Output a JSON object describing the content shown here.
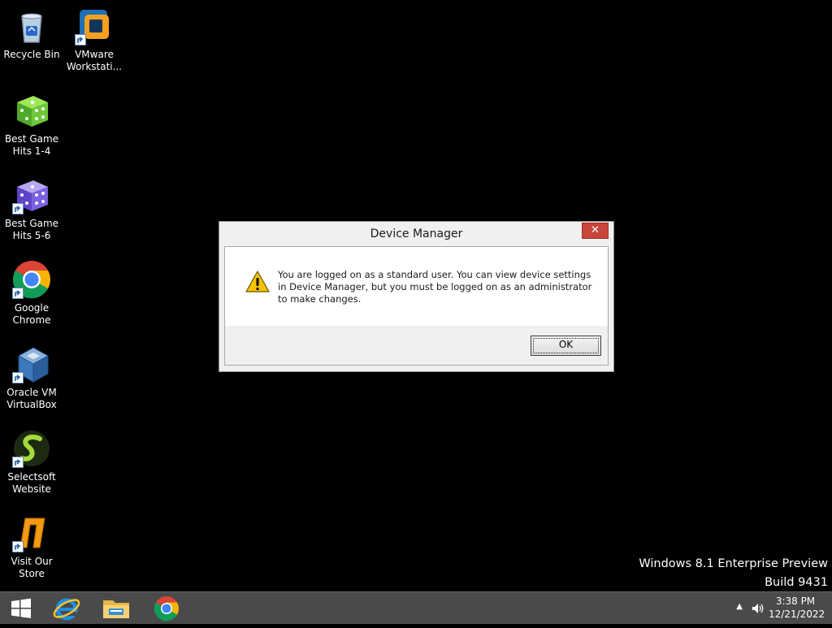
{
  "desktop": {
    "icons": [
      {
        "label": "Recycle Bin",
        "icon": "recycle-bin-icon"
      },
      {
        "label": "VMware Workstati...",
        "icon": "vmware-icon"
      },
      {
        "label": "Best Game Hits 1-4",
        "icon": "green-dice-icon"
      },
      {
        "label": "Best Game Hits 5-6",
        "icon": "purple-dice-icon"
      },
      {
        "label": "Google Chrome",
        "icon": "chrome-icon"
      },
      {
        "label": "Oracle VM VirtualBox",
        "icon": "virtualbox-icon"
      },
      {
        "label": "Selectsoft Website",
        "icon": "selectsoft-icon"
      },
      {
        "label": "Visit Our Store",
        "icon": "store-icon"
      }
    ]
  },
  "watermark": {
    "line1": "Windows 8.1 Enterprise Preview",
    "line2": "Build 9431"
  },
  "dialog": {
    "title": "Device Manager",
    "close_label": "✕",
    "message": "You are logged on as a standard user. You can view device settings in Device Manager, but you must be logged on as an administrator to make changes.",
    "ok_label": "OK",
    "icon": "warning-icon"
  },
  "taskbar": {
    "items": [
      "start-button",
      "internet-explorer-icon",
      "file-explorer-icon",
      "chrome-icon"
    ],
    "tray_arrow": "▲",
    "clock": {
      "time": "3:38 PM",
      "date": "12/21/2022"
    }
  },
  "colors": {
    "desktop_background": "#000000",
    "taskbar": "#4a4a4a",
    "close_button": "#c7463c",
    "dialog_frame": "#f0f0f0"
  }
}
